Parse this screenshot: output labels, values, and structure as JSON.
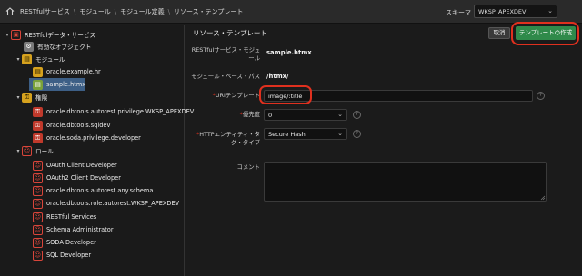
{
  "breadcrumb": [
    "RESTfulサービス",
    "モジュール",
    "モジュール定義",
    "リソース・テンプレート"
  ],
  "schema": {
    "label": "スキーマ",
    "value": "WKSP_APEXDEV"
  },
  "tree": {
    "root": "RESTfulデータ・サービス",
    "enabled": "有効なオブジェクト",
    "modules": "モジュール",
    "module_1": "oracle.example.hr",
    "module_2": "sample.htmx",
    "privileges": "権限",
    "priv_1": "oracle.dbtools.autorest.privilege.WKSP_APEXDEV",
    "priv_2": "oracle.dbtools.sqldev",
    "priv_3": "oracle.soda.privilege.developer",
    "roles": "ロール",
    "role_1": "OAuth Client Developer",
    "role_2": "OAuth2 Client Developer",
    "role_3": "oracle.dbtools.autorest.any.schema",
    "role_4": "oracle.dbtools.role.autorest.WKSP_APEXDEV",
    "role_5": "RESTful Services",
    "role_6": "Schema Administrator",
    "role_7": "SODA Developer",
    "role_8": "SQL Developer"
  },
  "main": {
    "title": "リソース・テンプレート",
    "cancel": "取消",
    "create": "テンプレートの作成",
    "module_label_1": "RESTfulサービス・モジュ",
    "module_label_2": "ール",
    "module_value": "sample.htmx",
    "base_path_label": "モジュール・ベース・パス",
    "base_path_value": "/htmx/",
    "uri_label": "URIテンプレート",
    "uri_value": "image/:title",
    "priority_label": "優先度",
    "priority_value": "0",
    "etag_label_1": "HTTPエンティティ・タ",
    "etag_label_2": "グ・タイプ",
    "etag_value": "Secure Hash",
    "comment_label": "コメント"
  },
  "colors": {
    "create_button": "#2f8a4a",
    "highlight_ring": "#e0301e",
    "selected_row": "#3d5f86"
  }
}
